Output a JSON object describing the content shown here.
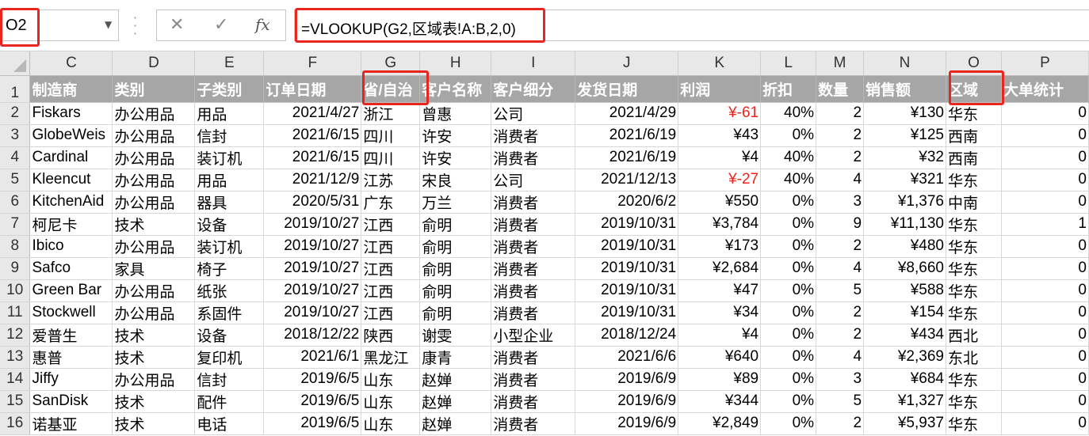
{
  "name_box": "O2",
  "formula_bar": {
    "cancel_icon": "✕",
    "enter_icon": "✓",
    "fx_label": "fx",
    "formula": "=VLOOKUP(G2,区域表!A:B,2,0)"
  },
  "columns": [
    "C",
    "D",
    "E",
    "F",
    "G",
    "H",
    "I",
    "J",
    "K",
    "L",
    "M",
    "N",
    "O",
    "P"
  ],
  "header_row_number": "1",
  "headers": [
    "制造商",
    "类别",
    "子类别",
    "订单日期",
    "省/自治",
    "客户名称",
    "客户细分",
    "发货日期",
    "利润",
    "折扣",
    "数量",
    "销售额",
    "区域",
    "大单统计"
  ],
  "rows": [
    {
      "num": "2",
      "cells": [
        "Fiskars",
        "办公用品",
        "用品",
        "2021/4/27",
        "浙江",
        "曾惠",
        "公司",
        "2021/4/29",
        "¥-61",
        "40%",
        "2",
        "¥130",
        "华东",
        "0"
      ]
    },
    {
      "num": "3",
      "cells": [
        "GlobeWeis",
        "办公用品",
        "信封",
        "2021/6/15",
        "四川",
        "许安",
        "消费者",
        "2021/6/19",
        "¥43",
        "0%",
        "2",
        "¥125",
        "西南",
        "0"
      ]
    },
    {
      "num": "4",
      "cells": [
        "Cardinal",
        "办公用品",
        "装订机",
        "2021/6/15",
        "四川",
        "许安",
        "消费者",
        "2021/6/19",
        "¥4",
        "40%",
        "2",
        "¥32",
        "西南",
        "0"
      ]
    },
    {
      "num": "5",
      "cells": [
        "Kleencut",
        "办公用品",
        "用品",
        "2021/12/9",
        "江苏",
        "宋良",
        "公司",
        "2021/12/13",
        "¥-27",
        "40%",
        "4",
        "¥321",
        "华东",
        "0"
      ]
    },
    {
      "num": "6",
      "cells": [
        "KitchenAid",
        "办公用品",
        "器具",
        "2020/5/31",
        "广东",
        "万兰",
        "消费者",
        "2020/6/2",
        "¥550",
        "0%",
        "3",
        "¥1,376",
        "中南",
        "0"
      ]
    },
    {
      "num": "7",
      "cells": [
        "柯尼卡",
        "技术",
        "设备",
        "2019/10/27",
        "江西",
        "俞明",
        "消费者",
        "2019/10/31",
        "¥3,784",
        "0%",
        "9",
        "¥11,130",
        "华东",
        "1"
      ]
    },
    {
      "num": "8",
      "cells": [
        "Ibico",
        "办公用品",
        "装订机",
        "2019/10/27",
        "江西",
        "俞明",
        "消费者",
        "2019/10/31",
        "¥173",
        "0%",
        "2",
        "¥480",
        "华东",
        "0"
      ]
    },
    {
      "num": "9",
      "cells": [
        "Safco",
        "家具",
        "椅子",
        "2019/10/27",
        "江西",
        "俞明",
        "消费者",
        "2019/10/31",
        "¥2,684",
        "0%",
        "4",
        "¥8,660",
        "华东",
        "0"
      ]
    },
    {
      "num": "10",
      "cells": [
        "Green Bar",
        "办公用品",
        "纸张",
        "2019/10/27",
        "江西",
        "俞明",
        "消费者",
        "2019/10/31",
        "¥47",
        "0%",
        "5",
        "¥588",
        "华东",
        "0"
      ]
    },
    {
      "num": "11",
      "cells": [
        "Stockwell",
        "办公用品",
        "系固件",
        "2019/10/27",
        "江西",
        "俞明",
        "消费者",
        "2019/10/31",
        "¥34",
        "0%",
        "2",
        "¥154",
        "华东",
        "0"
      ]
    },
    {
      "num": "12",
      "cells": [
        "爱普生",
        "技术",
        "设备",
        "2018/12/22",
        "陕西",
        "谢雯",
        "小型企业",
        "2018/12/24",
        "¥4",
        "0%",
        "2",
        "¥434",
        "西北",
        "0"
      ]
    },
    {
      "num": "13",
      "cells": [
        "惠普",
        "技术",
        "复印机",
        "2021/6/1",
        "黑龙江",
        "康青",
        "消费者",
        "2021/6/6",
        "¥640",
        "0%",
        "4",
        "¥2,369",
        "东北",
        "0"
      ]
    },
    {
      "num": "14",
      "cells": [
        "Jiffy",
        "办公用品",
        "信封",
        "2019/6/5",
        "山东",
        "赵婵",
        "消费者",
        "2019/6/9",
        "¥89",
        "0%",
        "3",
        "¥684",
        "华东",
        "0"
      ]
    },
    {
      "num": "15",
      "cells": [
        "SanDisk",
        "技术",
        "配件",
        "2019/6/5",
        "山东",
        "赵婵",
        "消费者",
        "2019/6/9",
        "¥344",
        "0%",
        "5",
        "¥1,327",
        "华东",
        "0"
      ]
    },
    {
      "num": "16",
      "cells": [
        "诺基亚",
        "技术",
        "电话",
        "2019/6/5",
        "山东",
        "赵婵",
        "消费者",
        "2019/6/9",
        "¥2,849",
        "0%",
        "2",
        "¥5,937",
        "华东",
        "0"
      ]
    }
  ],
  "colors": {
    "highlight_box": "#e8261f",
    "header_fill": "#a6a6a6",
    "negative_value": "#e8261f"
  }
}
